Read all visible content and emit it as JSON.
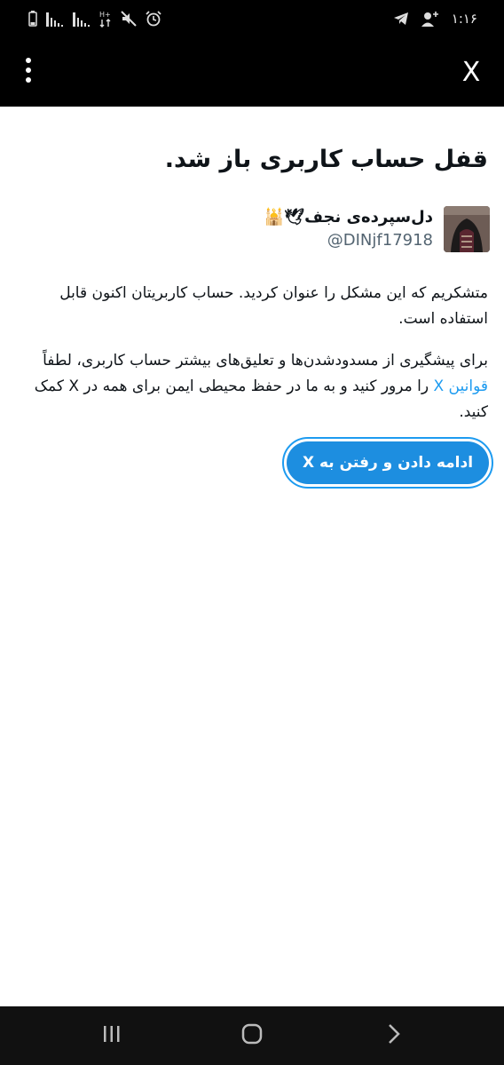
{
  "status_bar": {
    "time": "۱:۱۶",
    "icons": [
      "battery-low-icon",
      "signal-icon",
      "signal-icon",
      "data-transfer-icon",
      "mute-icon",
      "alarm-icon",
      "telegram-icon",
      "add-user-icon"
    ]
  },
  "app_bar": {
    "menu_icon": "vertical-ellipsis-icon",
    "close_label": "X"
  },
  "page": {
    "title": "قفل حساب کاربری باز شد.",
    "account": {
      "name": "دل‌سپرده‌ی نجف🕊🕌",
      "handle": "@DINjf17918"
    },
    "paragraph1": "متشکریم که این مشکل را عنوان کردید. حساب کاربریتان اکنون قابل استفاده است.",
    "paragraph2_before": "برای پیشگیری از مسدودشدن‌ها و تعلیق‌های بیشتر حساب کاربری، لطفاً ",
    "paragraph2_link": "قوانین X",
    "paragraph2_after": " را مرور کنید و به ما در حفظ محیطی ایمن برای همه در X کمک کنید.",
    "cta_label": "ادامه دادن و رفتن به X"
  },
  "nav_bar": {
    "buttons": [
      "recent-apps-icon",
      "home-icon",
      "back-icon"
    ]
  },
  "colors": {
    "accent": "#1d9bf0",
    "button": "#1d8ee0",
    "text": "#0f1419",
    "secondary_text": "#536471",
    "bar_background": "#000000"
  }
}
